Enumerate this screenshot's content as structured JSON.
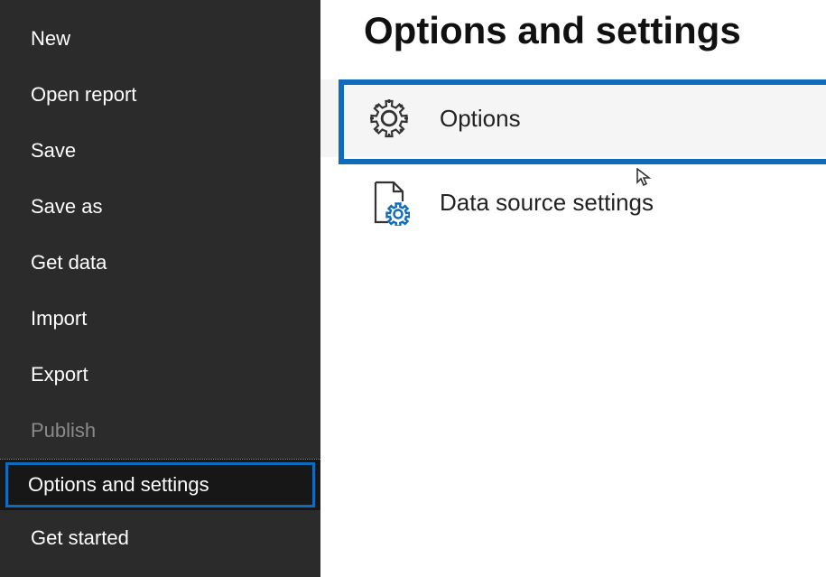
{
  "sidebar": {
    "items": [
      {
        "label": "New"
      },
      {
        "label": "Open report"
      },
      {
        "label": "Save"
      },
      {
        "label": "Save as"
      },
      {
        "label": "Get data"
      },
      {
        "label": "Import"
      },
      {
        "label": "Export"
      },
      {
        "label": "Publish",
        "disabled": true
      },
      {
        "label": "Options and settings",
        "selected": true
      },
      {
        "label": "Get started"
      }
    ]
  },
  "page": {
    "title": "Options and settings"
  },
  "main_items": [
    {
      "label": "Options",
      "icon": "gear-icon",
      "highlighted": true
    },
    {
      "label": "Data source settings",
      "icon": "data-source-icon",
      "highlighted": false
    }
  ]
}
